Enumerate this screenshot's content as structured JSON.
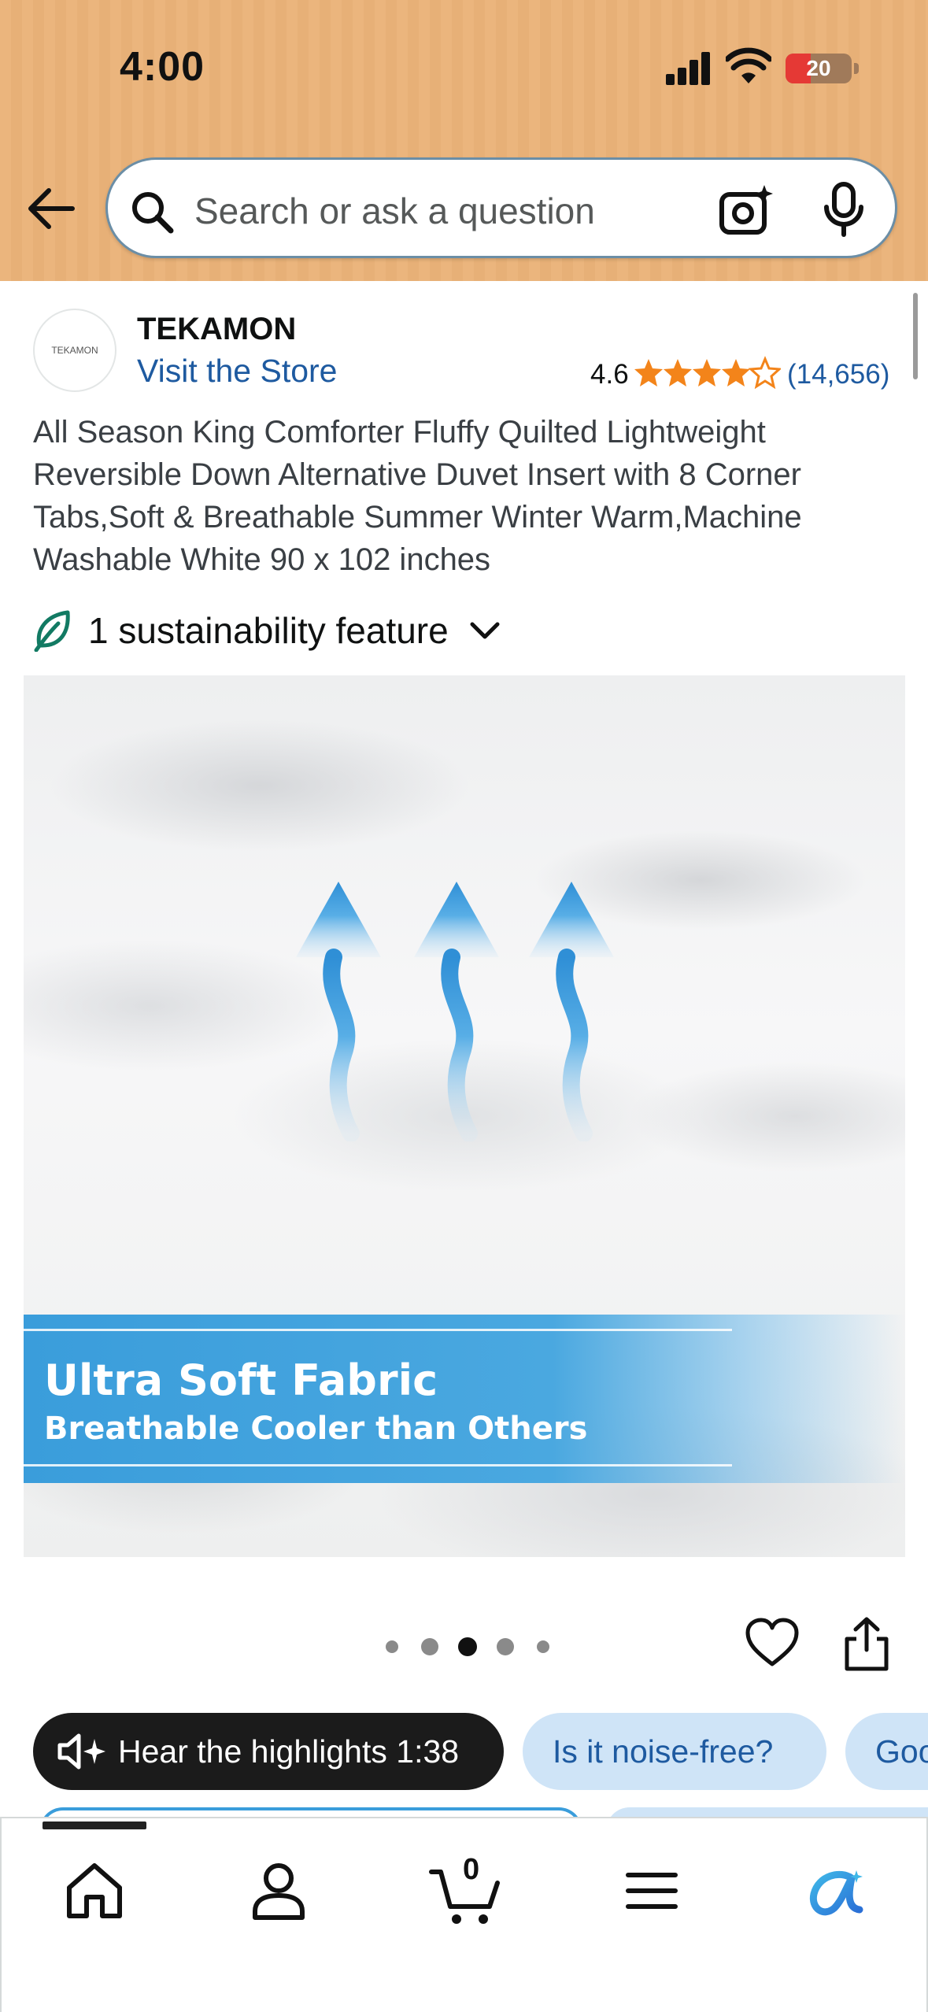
{
  "status_bar": {
    "time": "4:00",
    "battery": "20",
    "battery_level": 0.2
  },
  "search": {
    "placeholder": "Search or ask a question"
  },
  "store": {
    "logo_text": "TEKAMON",
    "brand": "TEKAMON",
    "visit_label": "Visit the Store",
    "rating": "4.6",
    "review_count": "(14,656)",
    "stars_value": 4.6
  },
  "product": {
    "title": "All Season King Comforter Fluffy Quilted Lightweight Reversible Down Alternative Duvet Insert with 8 Corner Tabs,Soft & Breathable Summer Winter Warm,Machine Washable White 90 x 102 inches",
    "sustainability": "1 sustainability feature",
    "image_banner_title": "Ultra Soft Fabric",
    "image_banner_subtitle": "Breathable Cooler than Others"
  },
  "carousel": {
    "total": 5,
    "active_index": 2
  },
  "chips": [
    {
      "label": "Hear the highlights 1:38"
    },
    {
      "label": "Is it noise-free?"
    },
    {
      "label": "Goo"
    }
  ],
  "tabbar": {
    "cart_count": "0",
    "items": [
      "home-icon",
      "account-icon",
      "cart-icon",
      "menu-icon",
      "rufus-icon"
    ]
  },
  "colors": {
    "header": "#ebb57d",
    "link": "#1e5aa0",
    "star": "#f3841a",
    "banner": "#3a9ddb",
    "chip_light": "#cfe4f7"
  }
}
